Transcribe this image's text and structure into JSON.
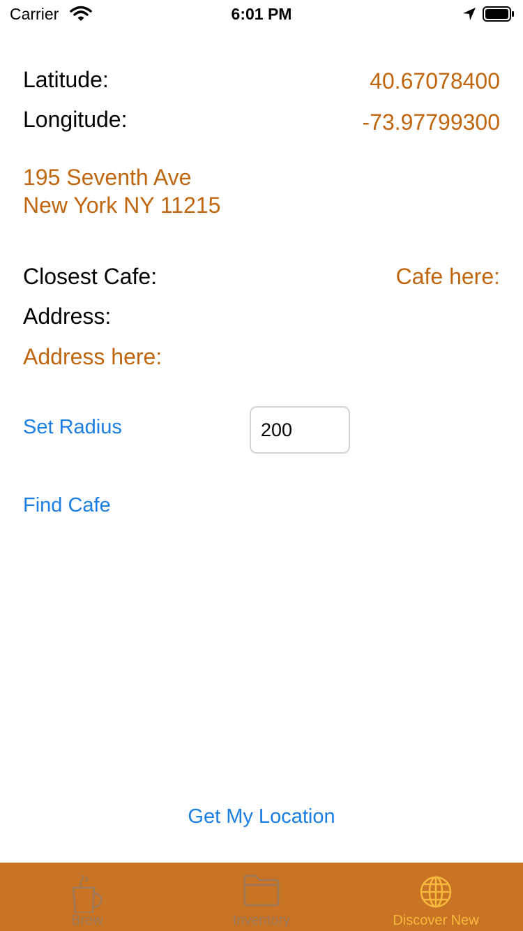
{
  "status_bar": {
    "carrier": "Carrier",
    "time": "6:01 PM"
  },
  "location": {
    "latitude_label": "Latitude:",
    "latitude_value": "40.67078400",
    "longitude_label": "Longitude:",
    "longitude_value": "-73.97799300",
    "address_line1": "195 Seventh Ave",
    "address_line2": "New York NY 11215"
  },
  "cafe": {
    "closest_label": "Closest Cafe:",
    "closest_value": "Cafe here:",
    "address_label": "Address:",
    "address_value": "Address here:"
  },
  "radius": {
    "set_label": "Set Radius",
    "value": "200"
  },
  "actions": {
    "find_cafe": "Find Cafe",
    "get_location": "Get My Location"
  },
  "tabs": [
    {
      "label": "Brew",
      "icon": "coffee-cup-icon",
      "active": false
    },
    {
      "label": "Inventory",
      "icon": "folder-icon",
      "active": false
    },
    {
      "label": "Discover New",
      "icon": "globe-icon",
      "active": true
    }
  ],
  "colors": {
    "accent_orange": "#c0660e",
    "link_blue": "#1a7ee3",
    "tab_bar": "#c97324",
    "tab_active": "#f7b93b",
    "tab_inactive": "#9c7a5b"
  }
}
